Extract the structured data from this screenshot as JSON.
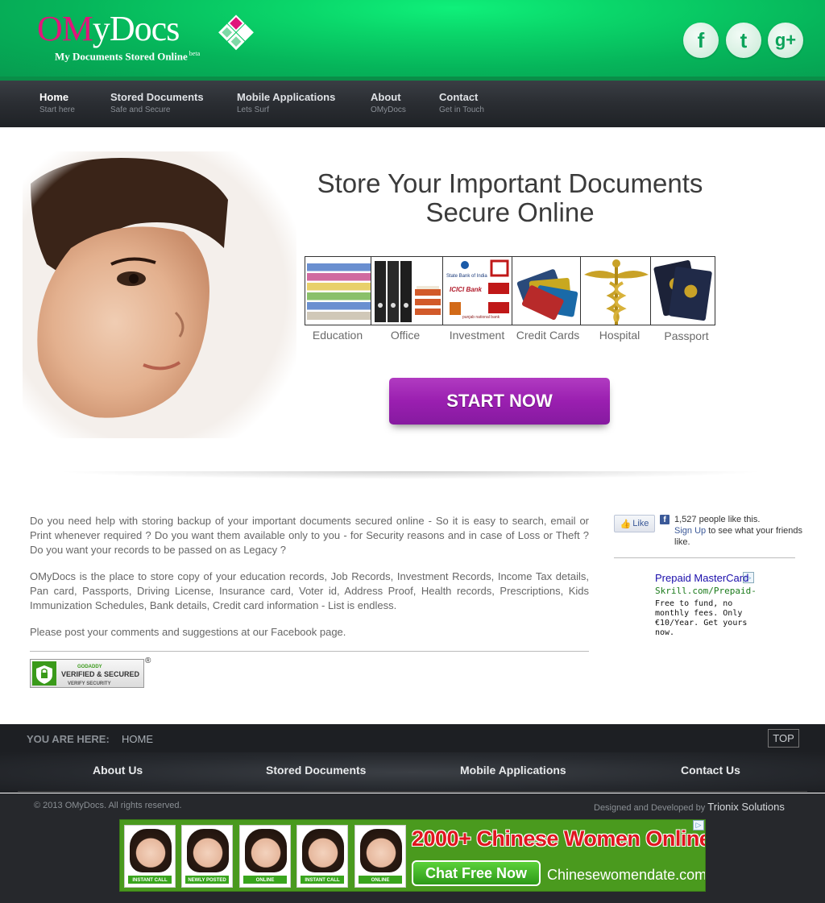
{
  "header": {
    "logo_om": "OM",
    "logo_rest": "yDocs",
    "tagline": "My Documents Stored Online",
    "tagline_sup": "beta",
    "social": [
      {
        "name": "facebook-icon",
        "glyph": "f"
      },
      {
        "name": "twitter-icon",
        "glyph": "t"
      },
      {
        "name": "google-plus-icon",
        "glyph": "g+"
      }
    ]
  },
  "nav": [
    {
      "label": "Home",
      "sub": "Start here"
    },
    {
      "label": "Stored Documents",
      "sub": "Safe and Secure"
    },
    {
      "label": "Mobile Applications",
      "sub": "Lets Surf"
    },
    {
      "label": "About",
      "sub": "OMyDocs"
    },
    {
      "label": "Contact",
      "sub": "Get in Touch"
    }
  ],
  "hero": {
    "title_line1": "Store Your Important Documents",
    "title_line2": "Secure Online",
    "categories": [
      "Education",
      "Office",
      "Investment",
      "Credit Cards",
      "Hospital",
      "Passport"
    ],
    "bank_names": [
      "State Bank of India",
      "ICICI Bank",
      "punjab national bank"
    ],
    "cta": "START NOW"
  },
  "content": {
    "p1": "Do you need help with storing backup of your important documents secured online - So it is easy to search, email or Print whenever required ? Do you want them available only to you - for Security reasons and in case of Loss or Theft ? Do you want your records to be passed on as Legacy ?",
    "p2": "OMyDocs is the place to store copy of your education records, Job Records, Investment Records, Income Tax details, Pan card, Passports, Driving License, Insurance card, Voter id, Address Proof, Health records, Prescriptions, Kids Immunization Schedules, Bank details, Credit card information - List is endless.",
    "p3": "Please post your comments and suggestions at our Facebook page.",
    "badge_top": "GODADDY",
    "badge_main": "VERIFIED & SECURED",
    "badge_sub": "VERIFY SECURITY",
    "badge_reg": "®"
  },
  "sidebar": {
    "like_label": "Like",
    "fb_count_text": "1,527 people like this.",
    "fb_signup": "Sign Up",
    "fb_rest": "to see what your friends like.",
    "ad_title": "Prepaid MasterCard",
    "ad_url": "Skrill.com/Prepaid-M…",
    "ad_desc": "Free to fund, no monthly fees. Only €10/Year. Get yours now.",
    "ad_choice": "▷"
  },
  "footer": {
    "breadcrumb_label": "YOU ARE HERE:",
    "breadcrumb_value": "HOME",
    "top": "TOP",
    "links": [
      "About Us",
      "Stored Documents",
      "Mobile Applications",
      "Contact Us"
    ],
    "copyright": "© 2013 OMyDocs. All rights reserved.",
    "designed_by": "Designed and Developed by",
    "company": "Trionix Solutions"
  },
  "banner": {
    "headline": "2000+ Chinese Women Online",
    "cta": "Chat Free Now",
    "url": "Chinesewomendate.com",
    "tags": [
      "INSTANT CALL",
      "NEWLY POSTED",
      "ONLINE",
      "INSTANT CALL",
      "ONLINE"
    ],
    "ad_choice": "▷"
  },
  "colors": {
    "header_green": "#06b45a",
    "brand_pink": "#e0157b",
    "cta_purple": "#9a1fb0",
    "nav_dark": "#2a2d32"
  }
}
